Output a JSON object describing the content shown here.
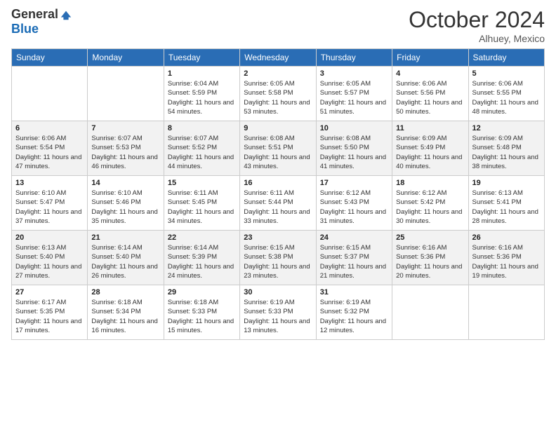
{
  "logo": {
    "general": "General",
    "blue": "Blue"
  },
  "title": "October 2024",
  "location": "Alhuey, Mexico",
  "days_header": [
    "Sunday",
    "Monday",
    "Tuesday",
    "Wednesday",
    "Thursday",
    "Friday",
    "Saturday"
  ],
  "weeks": [
    [
      {
        "day": "",
        "info": ""
      },
      {
        "day": "",
        "info": ""
      },
      {
        "day": "1",
        "info": "Sunrise: 6:04 AM\nSunset: 5:59 PM\nDaylight: 11 hours and 54 minutes."
      },
      {
        "day": "2",
        "info": "Sunrise: 6:05 AM\nSunset: 5:58 PM\nDaylight: 11 hours and 53 minutes."
      },
      {
        "day": "3",
        "info": "Sunrise: 6:05 AM\nSunset: 5:57 PM\nDaylight: 11 hours and 51 minutes."
      },
      {
        "day": "4",
        "info": "Sunrise: 6:06 AM\nSunset: 5:56 PM\nDaylight: 11 hours and 50 minutes."
      },
      {
        "day": "5",
        "info": "Sunrise: 6:06 AM\nSunset: 5:55 PM\nDaylight: 11 hours and 48 minutes."
      }
    ],
    [
      {
        "day": "6",
        "info": "Sunrise: 6:06 AM\nSunset: 5:54 PM\nDaylight: 11 hours and 47 minutes."
      },
      {
        "day": "7",
        "info": "Sunrise: 6:07 AM\nSunset: 5:53 PM\nDaylight: 11 hours and 46 minutes."
      },
      {
        "day": "8",
        "info": "Sunrise: 6:07 AM\nSunset: 5:52 PM\nDaylight: 11 hours and 44 minutes."
      },
      {
        "day": "9",
        "info": "Sunrise: 6:08 AM\nSunset: 5:51 PM\nDaylight: 11 hours and 43 minutes."
      },
      {
        "day": "10",
        "info": "Sunrise: 6:08 AM\nSunset: 5:50 PM\nDaylight: 11 hours and 41 minutes."
      },
      {
        "day": "11",
        "info": "Sunrise: 6:09 AM\nSunset: 5:49 PM\nDaylight: 11 hours and 40 minutes."
      },
      {
        "day": "12",
        "info": "Sunrise: 6:09 AM\nSunset: 5:48 PM\nDaylight: 11 hours and 38 minutes."
      }
    ],
    [
      {
        "day": "13",
        "info": "Sunrise: 6:10 AM\nSunset: 5:47 PM\nDaylight: 11 hours and 37 minutes."
      },
      {
        "day": "14",
        "info": "Sunrise: 6:10 AM\nSunset: 5:46 PM\nDaylight: 11 hours and 35 minutes."
      },
      {
        "day": "15",
        "info": "Sunrise: 6:11 AM\nSunset: 5:45 PM\nDaylight: 11 hours and 34 minutes."
      },
      {
        "day": "16",
        "info": "Sunrise: 6:11 AM\nSunset: 5:44 PM\nDaylight: 11 hours and 33 minutes."
      },
      {
        "day": "17",
        "info": "Sunrise: 6:12 AM\nSunset: 5:43 PM\nDaylight: 11 hours and 31 minutes."
      },
      {
        "day": "18",
        "info": "Sunrise: 6:12 AM\nSunset: 5:42 PM\nDaylight: 11 hours and 30 minutes."
      },
      {
        "day": "19",
        "info": "Sunrise: 6:13 AM\nSunset: 5:41 PM\nDaylight: 11 hours and 28 minutes."
      }
    ],
    [
      {
        "day": "20",
        "info": "Sunrise: 6:13 AM\nSunset: 5:40 PM\nDaylight: 11 hours and 27 minutes."
      },
      {
        "day": "21",
        "info": "Sunrise: 6:14 AM\nSunset: 5:40 PM\nDaylight: 11 hours and 26 minutes."
      },
      {
        "day": "22",
        "info": "Sunrise: 6:14 AM\nSunset: 5:39 PM\nDaylight: 11 hours and 24 minutes."
      },
      {
        "day": "23",
        "info": "Sunrise: 6:15 AM\nSunset: 5:38 PM\nDaylight: 11 hours and 23 minutes."
      },
      {
        "day": "24",
        "info": "Sunrise: 6:15 AM\nSunset: 5:37 PM\nDaylight: 11 hours and 21 minutes."
      },
      {
        "day": "25",
        "info": "Sunrise: 6:16 AM\nSunset: 5:36 PM\nDaylight: 11 hours and 20 minutes."
      },
      {
        "day": "26",
        "info": "Sunrise: 6:16 AM\nSunset: 5:36 PM\nDaylight: 11 hours and 19 minutes."
      }
    ],
    [
      {
        "day": "27",
        "info": "Sunrise: 6:17 AM\nSunset: 5:35 PM\nDaylight: 11 hours and 17 minutes."
      },
      {
        "day": "28",
        "info": "Sunrise: 6:18 AM\nSunset: 5:34 PM\nDaylight: 11 hours and 16 minutes."
      },
      {
        "day": "29",
        "info": "Sunrise: 6:18 AM\nSunset: 5:33 PM\nDaylight: 11 hours and 15 minutes."
      },
      {
        "day": "30",
        "info": "Sunrise: 6:19 AM\nSunset: 5:33 PM\nDaylight: 11 hours and 13 minutes."
      },
      {
        "day": "31",
        "info": "Sunrise: 6:19 AM\nSunset: 5:32 PM\nDaylight: 11 hours and 12 minutes."
      },
      {
        "day": "",
        "info": ""
      },
      {
        "day": "",
        "info": ""
      }
    ]
  ]
}
